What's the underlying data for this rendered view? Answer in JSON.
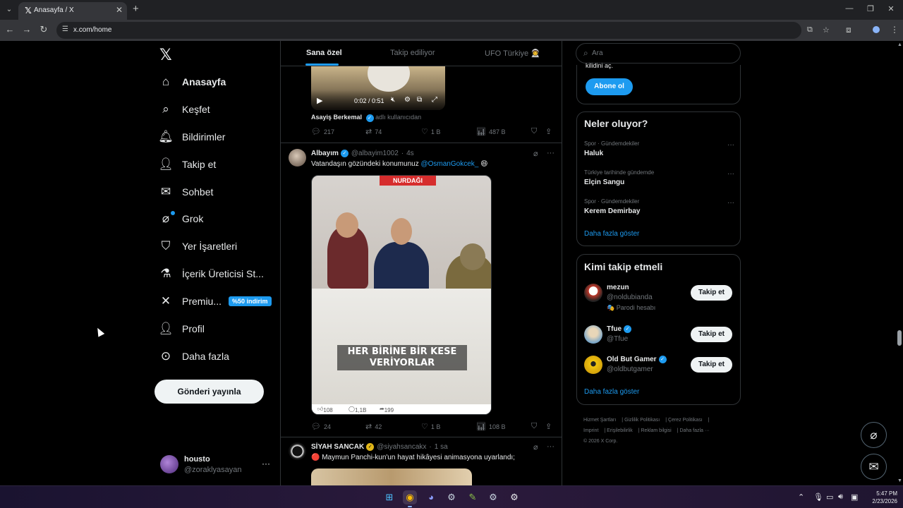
{
  "browser": {
    "tab_title": "Anasayfa / X",
    "url": "x.com/home"
  },
  "nav": {
    "items": [
      {
        "label": "Anasayfa",
        "icon": "home-icon"
      },
      {
        "label": "Keşfet",
        "icon": "search-icon"
      },
      {
        "label": "Bildirimler",
        "icon": "bell-icon"
      },
      {
        "label": "Takip et",
        "icon": "person-add-icon"
      },
      {
        "label": "Sohbet",
        "icon": "envelope-icon"
      },
      {
        "label": "Grok",
        "icon": "grok-icon"
      },
      {
        "label": "Yer İşaretleri",
        "icon": "bookmark-icon"
      },
      {
        "label": "İçerik Üreticisi St...",
        "icon": "flask-icon"
      },
      {
        "label": "Premiu...",
        "icon": "x-icon"
      },
      {
        "label": "Profil",
        "icon": "person-icon"
      },
      {
        "label": "Daha fazla",
        "icon": "more-circle-icon"
      }
    ],
    "premium_badge": "%50 indirim",
    "post_button": "Gönderi yayınla",
    "account": {
      "name": "housto",
      "handle": "@zoraklyasayan"
    }
  },
  "timeline": {
    "tabs": [
      "Sana özel",
      "Takip ediliyor",
      "UFO Türkiye 👨‍🚀"
    ],
    "video": {
      "time": "0:02 / 0:51"
    },
    "note": {
      "name": "Asayiş Berkemal",
      "context": "adlı kullanıcıdan"
    },
    "post1_actions": {
      "replies": "217",
      "reposts": "74",
      "likes": "1 B",
      "views": "487 B"
    },
    "post2": {
      "name": "Albayım",
      "handle": "@albayim1002",
      "time": "4s",
      "text": "Vatandaşın gözündeki konumunuz ",
      "mention": "@OsmanGokcek_",
      "emoji": "😄",
      "image_banner": "NURDAĞI",
      "caption_line1": "HER BİRİNE BİR KESE",
      "caption_line2": "VERİYORLAR",
      "image_footer": {
        "likes": "108",
        "comments": "1,1B",
        "shares": "199"
      },
      "actions": {
        "replies": "24",
        "reposts": "42",
        "likes": "1 B",
        "views": "108 B"
      }
    },
    "post3": {
      "name": "SİYAH SANCAK",
      "handle": "@siyahsancakx",
      "time": "1 sa",
      "text": "🔴 Maymun Panchi-kun'un hayat hikâyesi animasyona uyarlandı;"
    }
  },
  "sidebar": {
    "search_placeholder": "Ara",
    "subscribe_fragment": "kilidini aç.",
    "subscribe_button": "Abone ol",
    "trends_title": "Neler oluyor?",
    "trends": [
      {
        "context": "Spor · Gündemdekiler",
        "name": "Haluk"
      },
      {
        "context": "Türkiye tarihinde gündemde",
        "name": "Elçin Sangu"
      },
      {
        "context": "Spor · Gündemdekiler",
        "name": "Kerem Demirbay"
      }
    ],
    "show_more": "Daha fazla göster",
    "who_title": "Kimi takip etmeli",
    "follow_label": "Takip et",
    "who": [
      {
        "name": "mezun",
        "handle": "@noldubianda",
        "extra": "🎭 Parodi hesabı",
        "verified": false
      },
      {
        "name": "Tfue",
        "handle": "@Tfue",
        "extra": "",
        "verified": true
      },
      {
        "name": "Old But Gamer",
        "handle": "@oldbutgamer",
        "extra": "",
        "verified": true
      }
    ],
    "footer_links": [
      "Hizmet Şartları",
      "Gizlilik Politikası",
      "Çerez Politikası",
      "Imprint",
      "Erişilebilirlik",
      "Reklam bilgisi",
      "Daha fazla ···",
      "© 2026 X Corp."
    ]
  },
  "taskbar": {
    "time": "5:47 PM",
    "date": "2/23/2026"
  },
  "colors": {
    "accent": "#1d9bf0",
    "background": "#000000",
    "border": "#2f3336",
    "muted": "#71767b"
  }
}
